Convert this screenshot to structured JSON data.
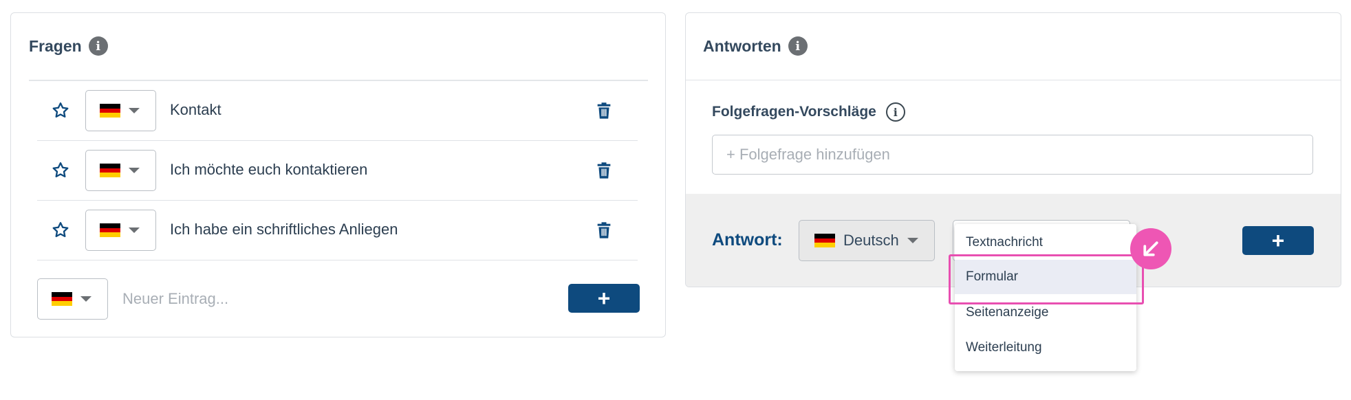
{
  "fragen": {
    "title": "Fragen",
    "info_icon": "i",
    "rows": [
      {
        "text": "Kontakt"
      },
      {
        "text": "Ich möchte euch kontaktieren"
      },
      {
        "text": "Ich habe ein schriftliches Anliegen"
      }
    ],
    "new_entry_placeholder": "Neuer Eintrag...",
    "add_label": "+"
  },
  "antworten": {
    "title": "Antworten",
    "info_icon": "i",
    "followup_title": "Folgefragen-Vorschläge",
    "followup_placeholder": "+ Folgefrage hinzufügen",
    "answer_label": "Antwort:",
    "language": "Deutsch",
    "add_label": "+",
    "type_options": [
      "Textnachricht",
      "Formular",
      "Seitenanzeige",
      "Weiterleitung"
    ]
  },
  "colors": {
    "primary": "#0e4a7e",
    "highlight": "#e84fb1",
    "flag": [
      "#000000",
      "#dd0000",
      "#ffce00"
    ]
  }
}
